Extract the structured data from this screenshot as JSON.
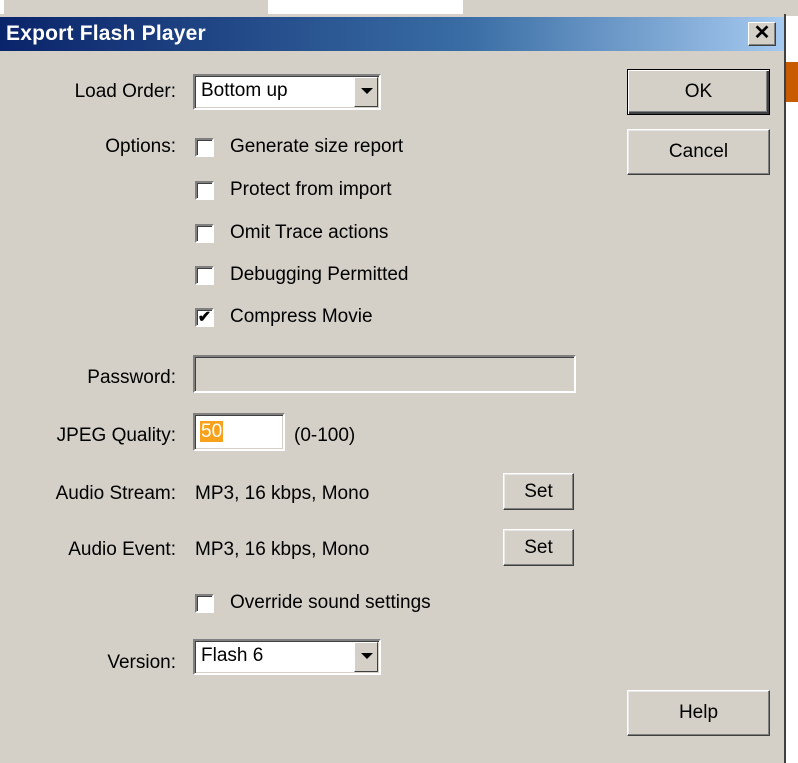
{
  "dialog": {
    "title": "Export Flash Player",
    "close_glyph": "✕"
  },
  "fields": {
    "load_order": {
      "label": "Load Order:",
      "value": "Bottom up"
    },
    "options_label": "Options:",
    "options": [
      {
        "label": "Generate size report",
        "checked": false
      },
      {
        "label": "Protect from import",
        "checked": false
      },
      {
        "label": "Omit Trace actions",
        "checked": false
      },
      {
        "label": "Debugging Permitted",
        "checked": false
      },
      {
        "label": "Compress Movie",
        "checked": true
      }
    ],
    "password": {
      "label": "Password:",
      "value": ""
    },
    "jpeg_quality": {
      "label": "JPEG Quality:",
      "value": "50",
      "range": "(0-100)"
    },
    "audio_stream": {
      "label": "Audio Stream:",
      "value": "MP3, 16 kbps, Mono",
      "button": "Set"
    },
    "audio_event": {
      "label": "Audio Event:",
      "value": "MP3, 16 kbps, Mono",
      "button": "Set"
    },
    "override": {
      "label": "Override sound settings",
      "checked": false
    },
    "version": {
      "label": "Version:",
      "value": "Flash 6"
    }
  },
  "buttons": {
    "ok": "OK",
    "cancel": "Cancel",
    "help": "Help"
  },
  "colors": {
    "titlebar_start": "#0a246a",
    "titlebar_end": "#a6caf0",
    "face": "#d4d0c8",
    "selection": "#f7a21a"
  }
}
